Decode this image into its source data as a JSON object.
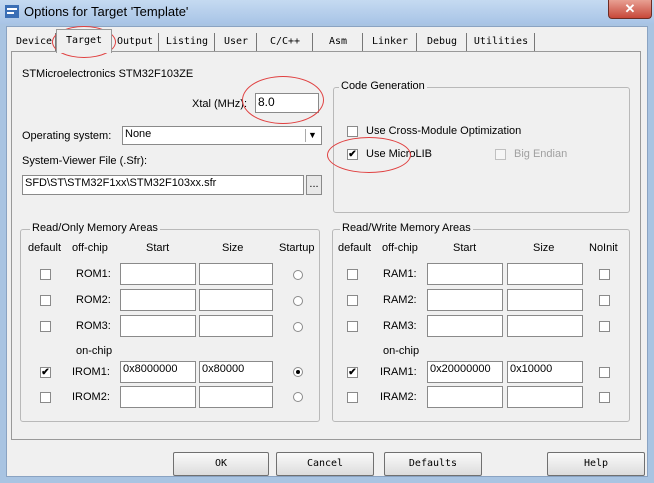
{
  "window": {
    "title": "Options for Target 'Template'",
    "close_glyph": "✕"
  },
  "tabs": [
    "Device",
    "Target",
    "Output",
    "Listing",
    "User",
    "C/C++",
    "Asm",
    "Linker",
    "Debug",
    "Utilities"
  ],
  "device": {
    "name": "STMicroelectronics STM32F103ZE"
  },
  "xtal": {
    "label": "Xtal (MHz):",
    "value": "8.0"
  },
  "os": {
    "label": "Operating system:",
    "value": "None"
  },
  "sfr": {
    "label": "System-Viewer File (.Sfr):",
    "value": "SFD\\ST\\STM32F1xx\\STM32F103xx.sfr",
    "browse": "..."
  },
  "codegen": {
    "title": "Code Generation",
    "cross_module": "Use Cross-Module Optimization",
    "microlib": "Use MicroLIB",
    "big_endian": "Big Endian"
  },
  "ro": {
    "title": "Read/Only Memory Areas",
    "headers": {
      "default": "default",
      "offchip": "off-chip",
      "start": "Start",
      "size": "Size",
      "startup": "Startup"
    },
    "onchip_label": "on-chip",
    "rows": [
      {
        "name": "ROM1:",
        "start": "",
        "size": "",
        "default": false,
        "startup": false
      },
      {
        "name": "ROM2:",
        "start": "",
        "size": "",
        "default": false,
        "startup": false
      },
      {
        "name": "ROM3:",
        "start": "",
        "size": "",
        "default": false,
        "startup": false
      },
      {
        "name": "IROM1:",
        "start": "0x8000000",
        "size": "0x80000",
        "default": true,
        "startup": true
      },
      {
        "name": "IROM2:",
        "start": "",
        "size": "",
        "default": false,
        "startup": false
      }
    ]
  },
  "rw": {
    "title": "Read/Write Memory Areas",
    "headers": {
      "default": "default",
      "offchip": "off-chip",
      "start": "Start",
      "size": "Size",
      "noinit": "NoInit"
    },
    "onchip_label": "on-chip",
    "rows": [
      {
        "name": "RAM1:",
        "start": "",
        "size": "",
        "default": false,
        "noinit": false
      },
      {
        "name": "RAM2:",
        "start": "",
        "size": "",
        "default": false,
        "noinit": false
      },
      {
        "name": "RAM3:",
        "start": "",
        "size": "",
        "default": false,
        "noinit": false
      },
      {
        "name": "IRAM1:",
        "start": "0x20000000",
        "size": "0x10000",
        "default": true,
        "noinit": false
      },
      {
        "name": "IRAM2:",
        "start": "",
        "size": "",
        "default": false,
        "noinit": false
      }
    ]
  },
  "buttons": {
    "ok": "OK",
    "cancel": "Cancel",
    "defaults": "Defaults",
    "help": "Help"
  },
  "checkmark": "✔",
  "annotation_color": "#e04040"
}
